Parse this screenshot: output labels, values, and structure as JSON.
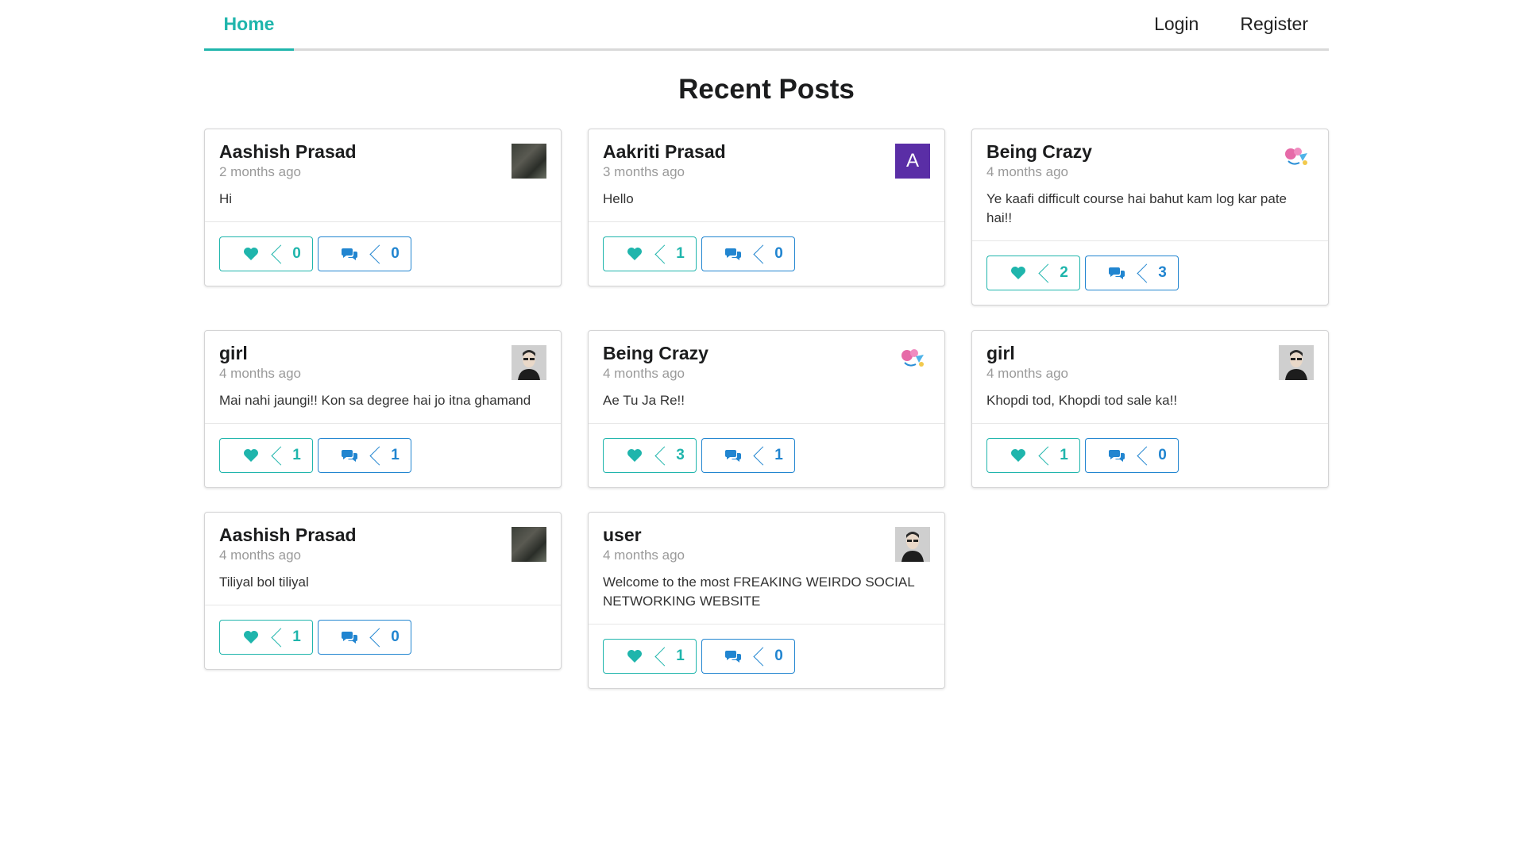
{
  "nav": {
    "home": "Home",
    "login": "Login",
    "register": "Register"
  },
  "page_title": "Recent Posts",
  "colors": {
    "accent_teal": "#1fb5ac",
    "accent_blue": "#2185d0",
    "avatar_letter_bg": "#5a2ea6"
  },
  "posts": [
    {
      "author": "Aashish Prasad",
      "time": "2 months ago",
      "text": "Hi",
      "likes": "0",
      "comments": "0",
      "avatar": "photo-avatar"
    },
    {
      "author": "Aakriti Prasad",
      "time": "3 months ago",
      "text": "Hello",
      "likes": "1",
      "comments": "0",
      "avatar": "letter-avatar",
      "avatar_letter": "A"
    },
    {
      "author": "Being Crazy",
      "time": "4 months ago",
      "text": "Ye kaafi difficult course hai bahut kam log kar pate hai!!",
      "likes": "2",
      "comments": "3",
      "avatar": "being-crazy-logo",
      "logo_text": "being crazy"
    },
    {
      "author": "girl",
      "time": "4 months ago",
      "text": "Mai nahi jaungi!! Kon sa degree hai jo itna ghamand",
      "likes": "1",
      "comments": "1",
      "avatar": "person-avatar"
    },
    {
      "author": "Being Crazy",
      "time": "4 months ago",
      "text": "Ae Tu Ja Re!!",
      "likes": "3",
      "comments": "1",
      "avatar": "being-crazy-logo",
      "logo_text": "being crazy"
    },
    {
      "author": "girl",
      "time": "4 months ago",
      "text": "Khopdi tod, Khopdi tod sale ka!!",
      "likes": "1",
      "comments": "0",
      "avatar": "person-avatar"
    },
    {
      "author": "Aashish Prasad",
      "time": "4 months ago",
      "text": "Tiliyal bol tiliyal",
      "likes": "1",
      "comments": "0",
      "avatar": "photo-avatar"
    },
    {
      "author": "user",
      "time": "4 months ago",
      "text": "Welcome to the most FREAKING WEIRDO SOCIAL NETWORKING WEBSITE",
      "likes": "1",
      "comments": "0",
      "avatar": "person-avatar"
    }
  ]
}
